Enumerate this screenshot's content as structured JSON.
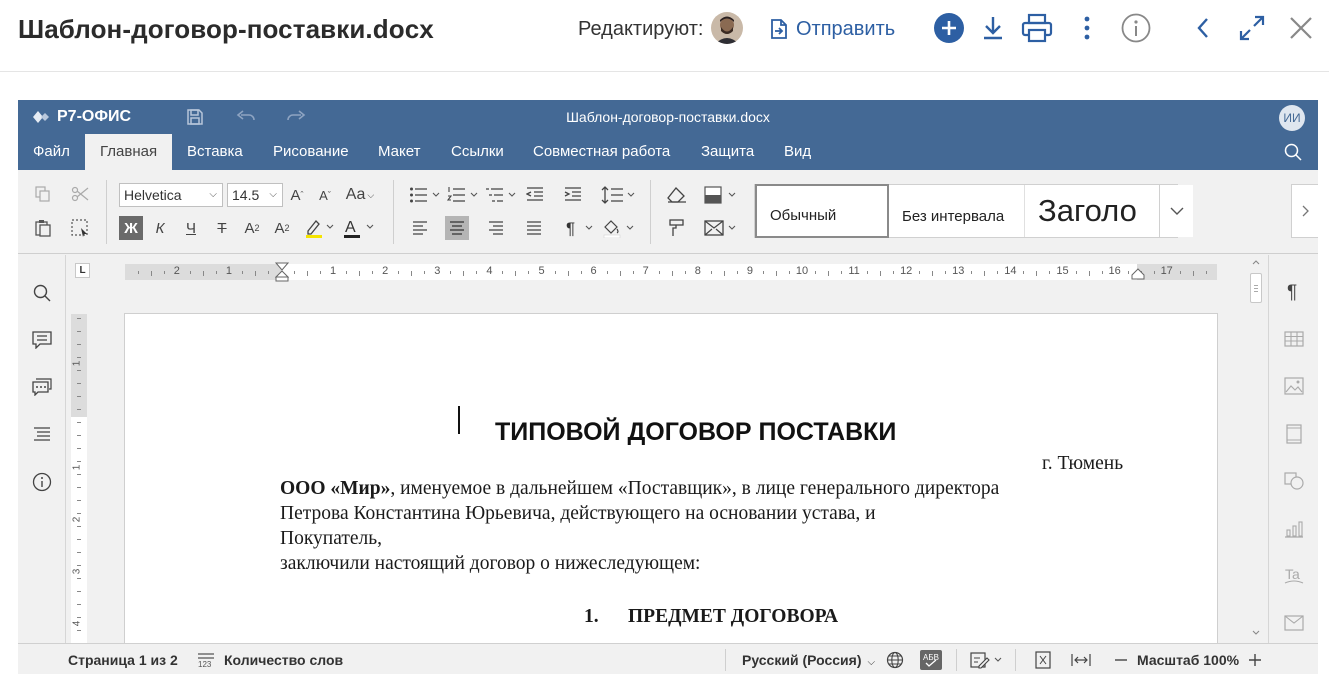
{
  "viewer": {
    "file_title": "Шаблон-договор-поставки.docx",
    "editing_label": "Редактируют:",
    "send_label": "Отправить"
  },
  "editor": {
    "app_name": "Р7-ОФИС",
    "doc_title": "Шаблон-договор-поставки.docx",
    "user_initials": "ИИ",
    "menu": [
      "Файл",
      "Главная",
      "Вставка",
      "Рисование",
      "Макет",
      "Ссылки",
      "Совместная работа",
      "Защита",
      "Вид"
    ],
    "active_tab": "Главная",
    "font_name": "Helvetica",
    "font_size": "14.5",
    "bold_glyph": "Ж",
    "italic_glyph": "К",
    "underline_glyph": "Ч",
    "strike_glyph": "Т",
    "styles": [
      "Обычный",
      "Без интервала",
      "Заголо"
    ]
  },
  "ruler": {
    "h_labels": [
      "2",
      "1",
      "1",
      "2",
      "3",
      "4",
      "5",
      "6",
      "7",
      "8",
      "9",
      "10",
      "11",
      "12",
      "13",
      "14",
      "15",
      "16",
      "17"
    ],
    "v_labels": [
      "1",
      "1",
      "2",
      "3",
      "4"
    ]
  },
  "document": {
    "heading": "ТИПОВОЙ ДОГОВОР ПОСТАВКИ",
    "city": "г. Тюмень",
    "company": "ООО «Мир»",
    "para1_rest": ", именуемое в дальнейшем «Поставщик», в лице генерального директора",
    "para2": "Петрова Константина Юрьевича, действующего на основании устава, и",
    "para3": "Покупатель,",
    "para4": "заключили настоящий договор о нижеследующем:",
    "section_number": "1.",
    "section_title": "ПРЕДМЕТ ДОГОВОРА"
  },
  "status": {
    "page_info": "Страница 1 из 2",
    "word_count": "Количество слов",
    "language": "Русский (Россия)",
    "zoom": "Масштаб 100%"
  },
  "colors": {
    "brand": "#446995",
    "link": "#2d5fa3",
    "add_button": "#2d5fa3"
  }
}
